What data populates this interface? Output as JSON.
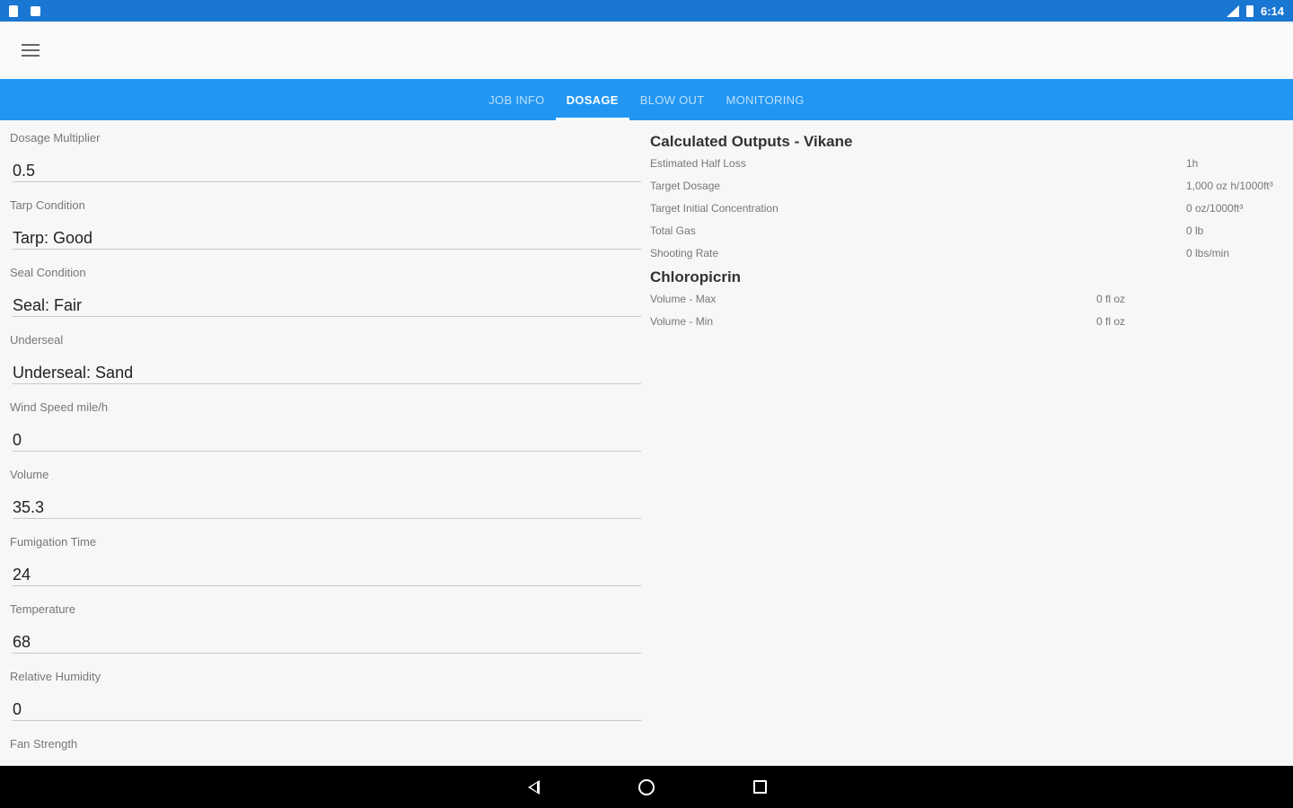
{
  "status_bar": {
    "time": "6:14"
  },
  "tabs": [
    {
      "label": "JOB INFO"
    },
    {
      "label": "DOSAGE"
    },
    {
      "label": "BLOW OUT"
    },
    {
      "label": "MONITORING"
    }
  ],
  "active_tab": "DOSAGE",
  "form": {
    "fields": [
      {
        "label": "Dosage Multiplier",
        "value": "0.5"
      },
      {
        "label": "Tarp Condition",
        "value": "Tarp: Good"
      },
      {
        "label": "Seal Condition",
        "value": "Seal: Fair"
      },
      {
        "label": "Underseal",
        "value": "Underseal: Sand"
      },
      {
        "label": "Wind Speed mile/h",
        "value": "0"
      },
      {
        "label": "Volume",
        "value": "35.3"
      },
      {
        "label": "Fumigation Time",
        "value": "24"
      },
      {
        "label": "Temperature",
        "value": "68"
      },
      {
        "label": "Relative Humidity",
        "value": "0"
      },
      {
        "label": "Fan Strength",
        "value": ""
      }
    ]
  },
  "outputs": {
    "vikane": {
      "title": "Calculated Outputs - Vikane",
      "rows": [
        {
          "label": "Estimated Half Loss",
          "value": "1h"
        },
        {
          "label": "Target Dosage",
          "value": "1,000 oz h/1000ft³"
        },
        {
          "label": "Target Initial Concentration",
          "value": "0 oz/1000ft³"
        },
        {
          "label": "Total Gas",
          "value": "0 lb"
        },
        {
          "label": "Shooting Rate",
          "value": "0 lbs/min"
        }
      ]
    },
    "chloropicrin": {
      "title": "Chloropicrin",
      "rows": [
        {
          "label": "Volume - Max",
          "value": "0 fl oz"
        },
        {
          "label": "Volume - Min",
          "value": "0 fl oz"
        }
      ]
    }
  },
  "icons": {
    "menu": "hamburger-menu-icon",
    "nav_back": "back-triangle-icon",
    "nav_home": "home-circle-icon",
    "nav_recent": "recent-apps-square-icon"
  },
  "colors": {
    "status_bar": "#1976d2",
    "tab_bar": "#2196f3",
    "background": "#f7f7f7",
    "nav_bar": "#000000"
  }
}
